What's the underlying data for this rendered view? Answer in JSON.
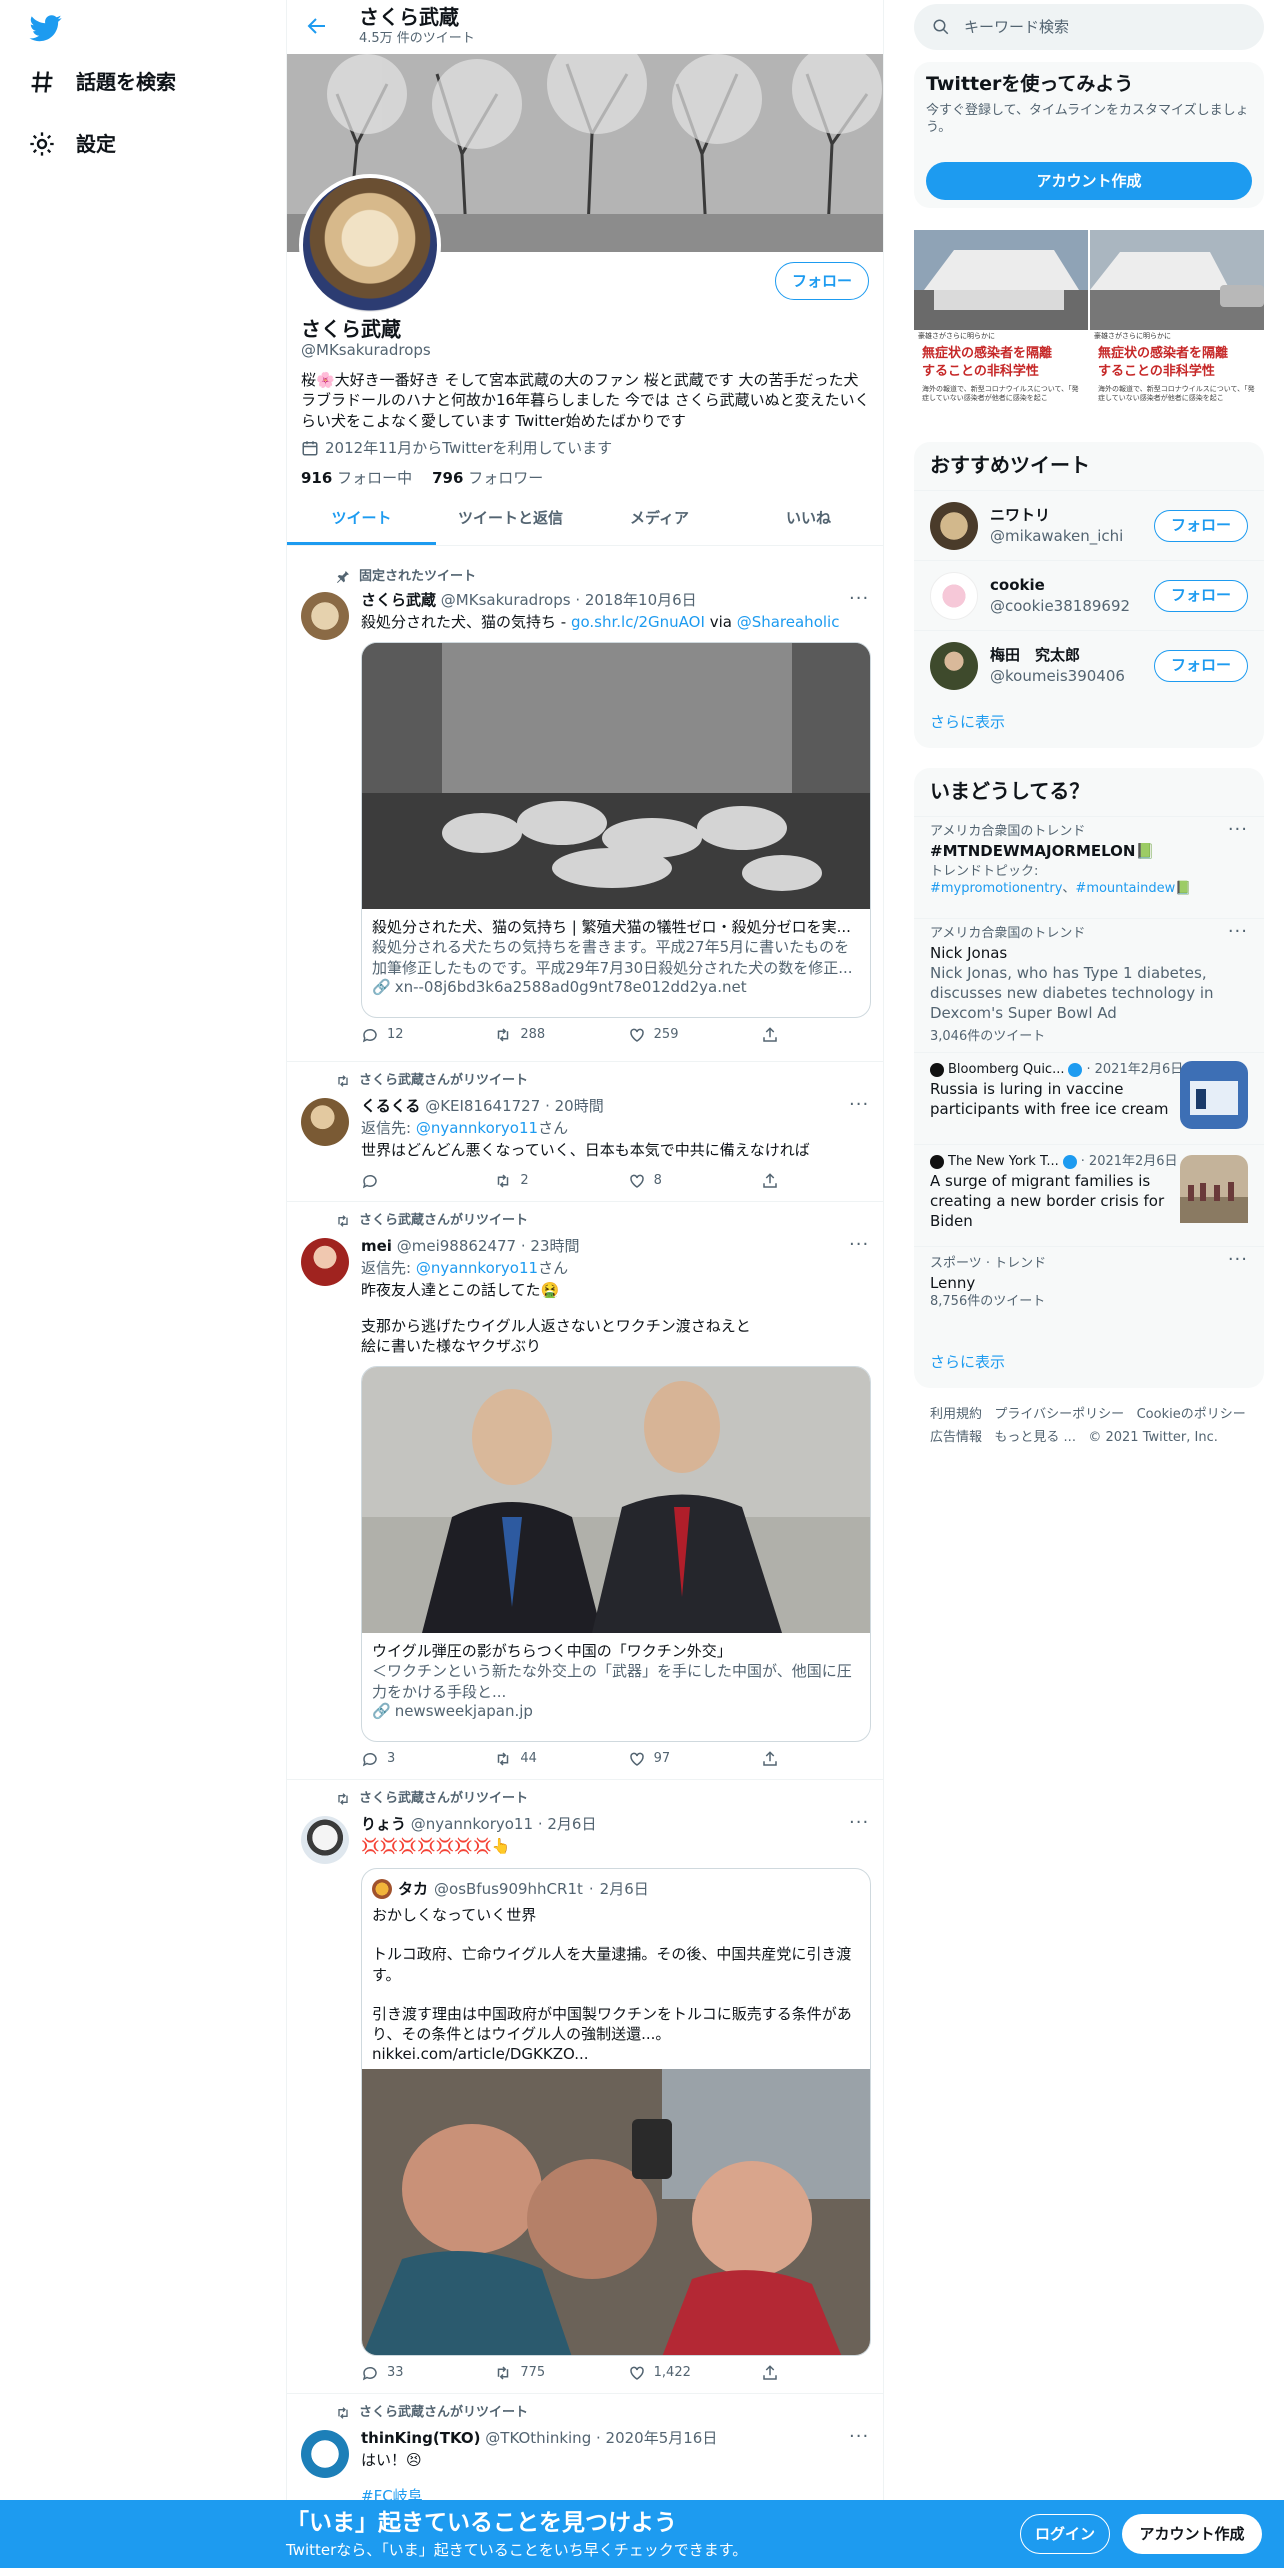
{
  "nav": {
    "explore_label": "話題を検索",
    "settings_label": "設定"
  },
  "header": {
    "name": "さくら武蔵",
    "tweet_count": "4.5万 件のツイート"
  },
  "profile": {
    "follow_label": "フォロー",
    "name": "さくら武蔵",
    "handle": "@MKsakuradrops",
    "bio": "桜🌸大好き一番好き そして宮本武蔵の大のファン 桜と武蔵です 大の苦手だった犬 ラブラドールのハナと何故か16年暮らしました 今では さくら武蔵いぬと変えたいくらい犬をこよなく愛しています Twitter始めたばかりです",
    "joined": "2012年11月からTwitterを利用しています",
    "following_count": "916",
    "following_label": "フォロー中",
    "followers_count": "796",
    "followers_label": "フォロワー"
  },
  "tabs": [
    "ツイート",
    "ツイートと返信",
    "メディア",
    "いいね"
  ],
  "tweets": [
    {
      "context": "固定されたツイート",
      "name": "さくら武蔵",
      "handle": "@MKsakuradrops",
      "time": "2018年10月6日",
      "text_prefix": "殺処分された犬、猫の気持ち - ",
      "link": "go.shr.lc/2GnuAOI",
      "via": " via ",
      "mention": "@Shareaholic",
      "card_title": "殺処分された犬、猫の気持ち | 繁殖犬猫の犠牲ゼロ・殺処分ゼロを実...",
      "card_desc": "殺処分される犬たちの気持ちを書きます。平成27年5月に書いたものを加筆修正したものです。平成29年7月30日殺処分された犬の数を修正...",
      "card_link": "xn--08j6bd3k6a2588ad0g9nt78e012dd2ya.net",
      "replies": "12",
      "retweets": "288",
      "likes": "259"
    },
    {
      "context": "さくら武蔵さんがリツイート",
      "name": "くるくる",
      "handle": "@KEI81641727",
      "time": "20時間",
      "reply_to_label": "返信先: ",
      "reply_to": "@nyannkoryo11",
      "reply_suffix": "さん",
      "text": "世界はどんどん悪くなっていく、日本も本気で中共に備えなければ",
      "replies": "",
      "retweets": "2",
      "likes": "8"
    },
    {
      "context": "さくら武蔵さんがリツイート",
      "name": "mei",
      "handle": "@mei98862477",
      "time": "23時間",
      "reply_to_label": "返信先: ",
      "reply_to": "@nyannkoryo11",
      "reply_suffix": "さん",
      "text1": "昨夜友人達とこの話してた🤮",
      "text2": "支那から逃げたウイグル人返さないとワクチン渡さねえと",
      "text3": "絵に書いた様なヤクザぶり",
      "card_title": "ウイグル弾圧の影がちらつく中国の「ワクチン外交」",
      "card_desc": "＜ワクチンという新たな外交上の「武器」を手にした中国が、他国に圧力をかける手段と...",
      "card_link": "newsweekjapan.jp",
      "replies": "3",
      "retweets": "44",
      "likes": "97"
    },
    {
      "context": "さくら武蔵さんがリツイート",
      "name": "りょう",
      "handle": "@nyannkoryo11",
      "time": "2月6日",
      "text": "💢💢💢💢💢💢💢👆",
      "quote_name": "タカ",
      "quote_handle": "@osBfus909hhCR1t",
      "quote_time": "2月6日",
      "quote_text1": "おかしくなっていく世界",
      "quote_text2": "トルコ政府、亡命ウイグル人を大量逮捕。その後、中国共産党に引き渡す。",
      "quote_text3": "引き渡す理由は中国政府が中国製ワクチンをトルコに販売する条件があり、その条件とはウイグル人の強制送還...。",
      "quote_link": "nikkei.com/article/DGKKZO...",
      "replies": "33",
      "retweets": "775",
      "likes": "1,422"
    },
    {
      "context": "さくら武蔵さんがリツイート",
      "name": "thinKing(TKO)",
      "handle": "@TKOthinking",
      "time": "2020年5月16日",
      "text": "はい！😣",
      "hashtag": "#FC岐阜"
    }
  ],
  "right": {
    "search_placeholder": "キーワード検索",
    "signup_title": "Twitterを使ってみよう",
    "signup_desc": "今すぐ登録して、タイムラインをカスタマイズしましょう。",
    "signup_button": "アカウント作成",
    "banner_headline1": "無症状の感染者を隔離",
    "banner_headline2": "することの非科学性",
    "banner_small": "海外の報道で、新型コロナウイルスについて、「発症していない感染者が他者に感染を起こ",
    "banner_top": "豪雄さがさらに明らかに",
    "wtf_title": "おすすめツイート",
    "wtf": [
      {
        "name": "ニワトリ",
        "handle": "@mikawaken_ichi"
      },
      {
        "name": "cookie",
        "handle": "@cookie38189692"
      },
      {
        "name": "梅田　究太郎",
        "handle": "@koumeis390406"
      }
    ],
    "follow_label": "フォロー",
    "show_more": "さらに表示",
    "trends_title": "いまどうしてる？",
    "trend1": {
      "sub": "アメリカ合衆国のトレンド",
      "name": "#MTNDEWMAJORMELON📗",
      "topic_label": "トレンドトピック: ",
      "topic1": "#mypromotionentry",
      "sep": "、",
      "topic2": "#mountaindew📗"
    },
    "trend2": {
      "sub": "アメリカ合衆国のトレンド",
      "name": "Nick Jonas",
      "desc": "Nick Jonas, who has Type 1 diabetes, discusses new diabetes technology in Dexcom's Super Bowl Ad",
      "count": "3,046件のツイート"
    },
    "news1": {
      "source": "Bloomberg Quic...",
      "time": "2021年2月6日",
      "title": "Russia is luring in vaccine participants with free ice cream"
    },
    "news2": {
      "source": "The New York T...",
      "time": "2021年2月6日",
      "title": "A surge of migrant families is creating a new border crisis for Biden"
    },
    "trend3": {
      "sub": "スポーツ · トレンド",
      "name": "Lenny",
      "count": "8,756件のツイート"
    },
    "footer_links": [
      "利用規約",
      "プライバシーポリシー",
      "Cookieのポリシー",
      "広告情報",
      "もっと見る ...",
      "© 2021 Twitter, Inc."
    ]
  },
  "bottom": {
    "title": "「いま」起きていることを見つけよう",
    "subtitle": "Twitterなら、「いま」起きていることをいち早くチェックできます。",
    "login": "ログイン",
    "signup": "アカウント作成"
  },
  "colors": {
    "accent": "#1d9bf0",
    "text": "#0f1419",
    "muted": "#536471"
  }
}
